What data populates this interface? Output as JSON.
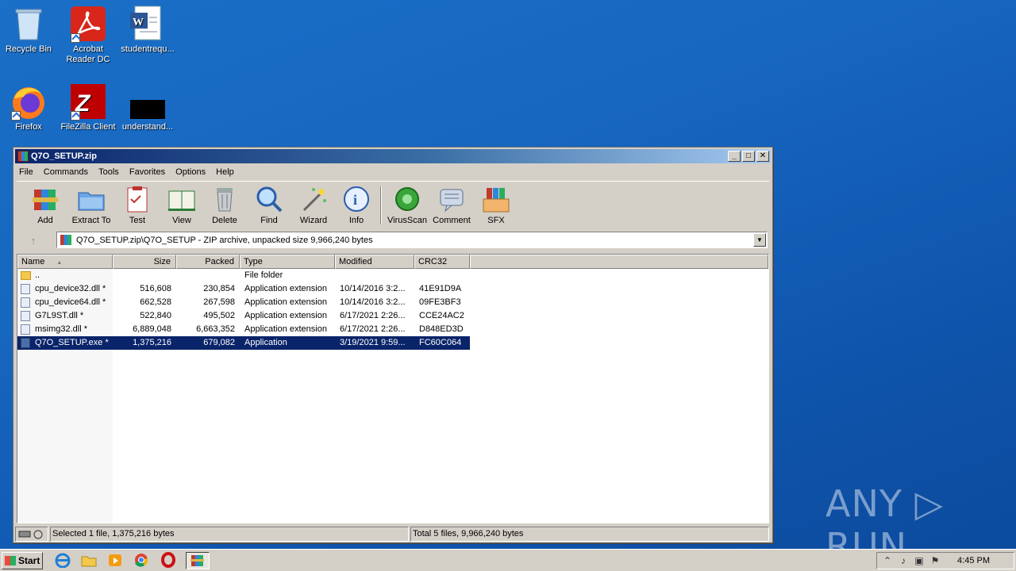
{
  "desktop": {
    "icons": [
      {
        "label": "Recycle Bin"
      },
      {
        "label": "Acrobat Reader DC"
      },
      {
        "label": "studentrequ..."
      },
      {
        "label": "Firefox"
      },
      {
        "label": "FileZilla Client"
      },
      {
        "label": "understand..."
      }
    ]
  },
  "window": {
    "title": "Q7O_SETUP.zip",
    "buttons": {
      "minimize": "_",
      "maximize": "□",
      "close": "✕"
    },
    "menu": [
      "File",
      "Commands",
      "Tools",
      "Favorites",
      "Options",
      "Help"
    ],
    "toolbar": [
      "Add",
      "Extract To",
      "Test",
      "View",
      "Delete",
      "Find",
      "Wizard",
      "Info",
      "VirusScan",
      "Comment",
      "SFX"
    ],
    "address": "Q7O_SETUP.zip\\Q7O_SETUP - ZIP archive, unpacked size 9,966,240 bytes",
    "up_arrow": "↑",
    "dropdown_arrow": "▼",
    "columns": [
      "Name",
      "Size",
      "Packed",
      "Type",
      "Modified",
      "CRC32"
    ],
    "sort_indicator": "▲",
    "rows": [
      {
        "name": "..",
        "size": "",
        "packed": "",
        "type": "File folder",
        "modified": "",
        "crc": ""
      },
      {
        "name": "cpu_device32.dll *",
        "size": "516,608",
        "packed": "230,854",
        "type": "Application extension",
        "modified": "10/14/2016 3:2...",
        "crc": "41E91D9A"
      },
      {
        "name": "cpu_device64.dll *",
        "size": "662,528",
        "packed": "267,598",
        "type": "Application extension",
        "modified": "10/14/2016 3:2...",
        "crc": "09FE3BF3"
      },
      {
        "name": "G7L9ST.dll *",
        "size": "522,840",
        "packed": "495,502",
        "type": "Application extension",
        "modified": "6/17/2021 2:26...",
        "crc": "CCE24AC2"
      },
      {
        "name": "msimg32.dll *",
        "size": "6,889,048",
        "packed": "6,663,352",
        "type": "Application extension",
        "modified": "6/17/2021 2:26...",
        "crc": "D848ED3D"
      },
      {
        "name": "Q7O_SETUP.exe *",
        "size": "1,375,216",
        "packed": "679,082",
        "type": "Application",
        "modified": "3/19/2021 9:59...",
        "crc": "FC60C064"
      }
    ],
    "status_left": "Selected 1 file, 1,375,216 bytes",
    "status_right": "Total 5 files, 9,966,240 bytes"
  },
  "watermark": "ANY ▷ RUN",
  "taskbar": {
    "start_label": "Start",
    "clock": "4:45 PM"
  },
  "colors": {
    "selection": "#0a246a",
    "desktop": "#1766c0",
    "titlebar": "#0a246a"
  }
}
